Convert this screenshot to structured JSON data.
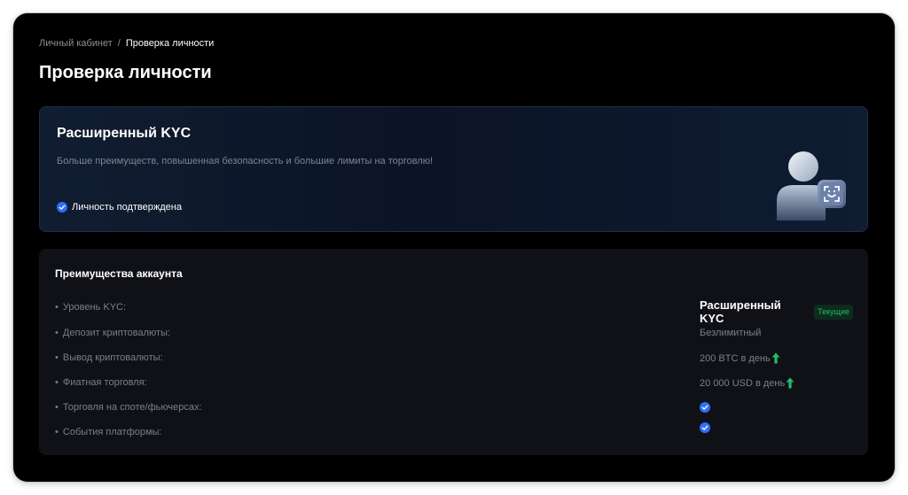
{
  "breadcrumb": {
    "parent": "Личный кабинет",
    "separator": "/",
    "current": "Проверка личности"
  },
  "page_title": "Проверка личности",
  "kyc_card": {
    "title": "Расширенный KYC",
    "description": "Больше преимуществ, повышенная безопасность и большие лимиты на торговлю!",
    "status": "Личность подтверждена",
    "icons": [
      "check-circle-icon",
      "face-id-user-icon"
    ]
  },
  "benefits": {
    "title": "Преимущества аккаунта",
    "bullet": "•",
    "rows": [
      {
        "label": "Уровень KYC:",
        "value": "Расширенный KYC",
        "badge": "Текущие"
      },
      {
        "label": "Депозит криптовалюты:",
        "value": "Безлимитный"
      },
      {
        "label": "Вывод криптовалюты:",
        "value": "200 BTC в день",
        "icon": "arrow-up-icon"
      },
      {
        "label": "Фиатная торговля:",
        "value": "20 000 USD в день",
        "icon": "arrow-up-icon"
      },
      {
        "label": "Торговля на споте/фьючерсах:",
        "icon": "check-circle-icon"
      },
      {
        "label": "События платформы:",
        "icon": "check-circle-icon"
      }
    ]
  },
  "colors": {
    "background": "#000000",
    "accent_blue": "#2f6fff",
    "accent_green": "#1fbf6a",
    "muted_text": "#7a7f89"
  }
}
